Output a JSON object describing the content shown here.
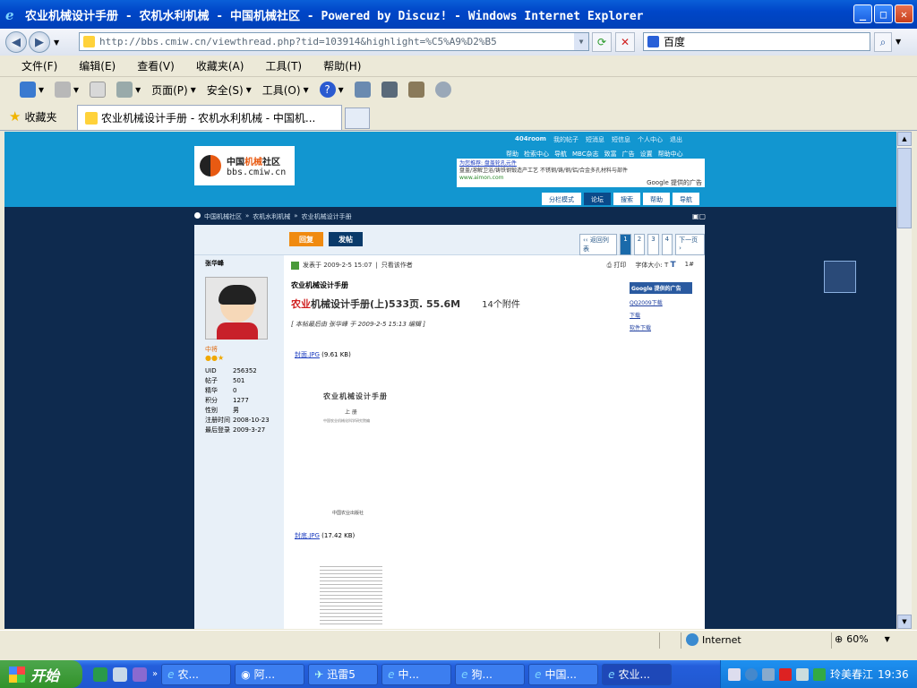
{
  "window": {
    "title": "农业机械设计手册 - 农机水利机械 - 中国机械社区 - Powered by Discuz! - Windows Internet Explorer"
  },
  "browser": {
    "address": "http://bbs.cmiw.cn/viewthread.php?tid=103914&highlight=%C5%A9%D2%B5",
    "search_value": "百度",
    "menu": [
      "文件(F)",
      "编辑(E)",
      "查看(V)",
      "收藏夹(A)",
      "工具(T)",
      "帮助(H)"
    ],
    "toolbar": {
      "page": "页面(P)",
      "safety": "安全(S)",
      "tools": "工具(O)"
    },
    "favorites": "收藏夹",
    "tab_title": "农业机械设计手册 - 农机水利机械 - 中国机..."
  },
  "site": {
    "logo_name_a": "中国",
    "logo_name_b": "机械",
    "logo_name_c": "社区",
    "logo_url": "bbs.cmiw.cn",
    "top_links": [
      "404room",
      "我的帖子",
      "短消息",
      "短信息",
      "个人中心",
      "退出"
    ],
    "top_links2": [
      "帮助",
      "检索中心",
      "导航",
      "MBC杂志",
      "致富",
      "广告",
      "设置",
      "帮助中心"
    ],
    "ad_line1": "为您推荐: 盘盖轮孔元件",
    "ad_line2": "盘盖/溶解卫浴/铸铁钢锻造产工艺 不锈钢/铸/钢/铝/合金多孔材料与部件",
    "ad_url": "www.aimon.com",
    "ad_google": "Google 提供的广告",
    "nav_tabs": [
      "分栏模式",
      "论坛",
      "搜索",
      "帮助",
      "导航"
    ],
    "nav_active_index": 1,
    "breadcrumb": [
      "中国机械社区",
      "农机水利机械",
      "农业机械设计手册"
    ]
  },
  "post": {
    "reply_button": "回复",
    "new_button": "发帖",
    "pager": [
      "‹‹ 返回列表",
      "1",
      "2",
      "3",
      "4",
      "下一页 ›"
    ],
    "author": "张华峰",
    "rank": "中将",
    "stats": [
      {
        "k": "UID",
        "v": "256352"
      },
      {
        "k": "帖子",
        "v": "501"
      },
      {
        "k": "精华",
        "v": "0"
      },
      {
        "k": "积分",
        "v": "1277"
      },
      {
        "k": "性别",
        "v": "男"
      },
      {
        "k": "注册时间",
        "v": "2008-10-23"
      },
      {
        "k": "最后登录",
        "v": "2009-3-27"
      }
    ],
    "posted": "发表于 2009-2-5 15:07",
    "only_author": "只看该作者",
    "print": "打印",
    "font_size": "字体大小:",
    "floor": "1#",
    "subject": "农业机械设计手册",
    "title_red": "农业",
    "title_rest": "机械设计手册(上)533页. 55.6M",
    "attachments": "14个附件",
    "edited": "[ 本帖最后由 张华峰 于 2009-2-5 15:13 编辑 ]",
    "google_header": "Google 提供的广告",
    "google_links": [
      "QQ2009下载",
      "下载",
      "软件下载"
    ],
    "attach1_name": "封面.JPG",
    "attach1_size": "(9.61 KB)",
    "attach2_name": "封底.JPG",
    "attach2_size": "(17.42 KB)",
    "img1_title": "农业机械设计手册",
    "img1_vol": "上  册",
    "img1_sub": "中国农业机械化科学研究院编",
    "img1_pub": "中国农业出版社"
  },
  "status": {
    "zone": "Internet",
    "zoom": "60%"
  },
  "taskbar": {
    "start": "开始",
    "tasks": [
      "农...",
      "阿...",
      "迅雷5",
      "中...",
      "狗...",
      "中国...",
      "农业..."
    ],
    "active_index": 6,
    "tray_text": "玲美春江",
    "clock": "19:36"
  }
}
